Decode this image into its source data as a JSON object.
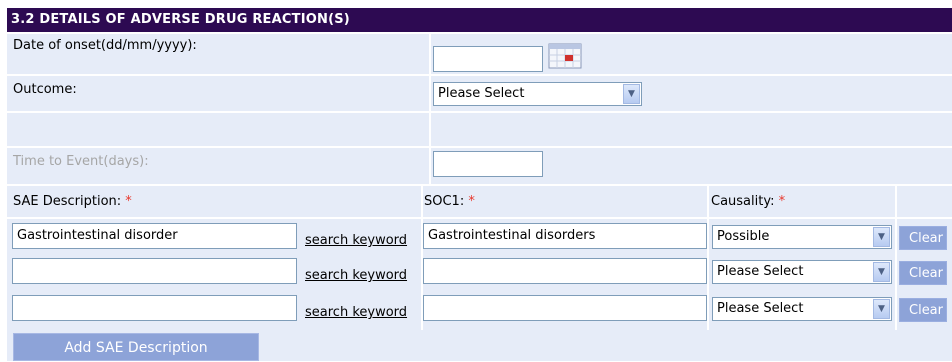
{
  "section_title": "3.2 DETAILS OF ADVERSE DRUG REACTION(S)",
  "fields": {
    "date_of_onset_label": "Date of onset(dd/mm/yyyy):",
    "date_of_onset_value": "",
    "outcome_label": "Outcome:",
    "outcome_value": "Please Select",
    "time_to_event_label": "Time to Event(days):",
    "time_to_event_value": ""
  },
  "sae_table": {
    "headers": {
      "sae_description": "SAE Description:",
      "soc1": "SOC1:",
      "causality": "Causality:",
      "required_mark": "*"
    },
    "search_link_label": "search keyword",
    "clear_label": "Clear",
    "rows": [
      {
        "description": "Gastrointestinal disorder",
        "soc1": "Gastrointestinal disorders",
        "causality": "Possible"
      },
      {
        "description": "",
        "soc1": "",
        "causality": "Please Select"
      },
      {
        "description": "",
        "soc1": "",
        "causality": "Please Select"
      }
    ]
  },
  "add_button_label": "Add SAE Description",
  "colors": {
    "header_bg": "#2d0a52",
    "cell_bg": "#e6ecf8",
    "button_bg": "#8da3d8",
    "required": "#e8362b"
  }
}
